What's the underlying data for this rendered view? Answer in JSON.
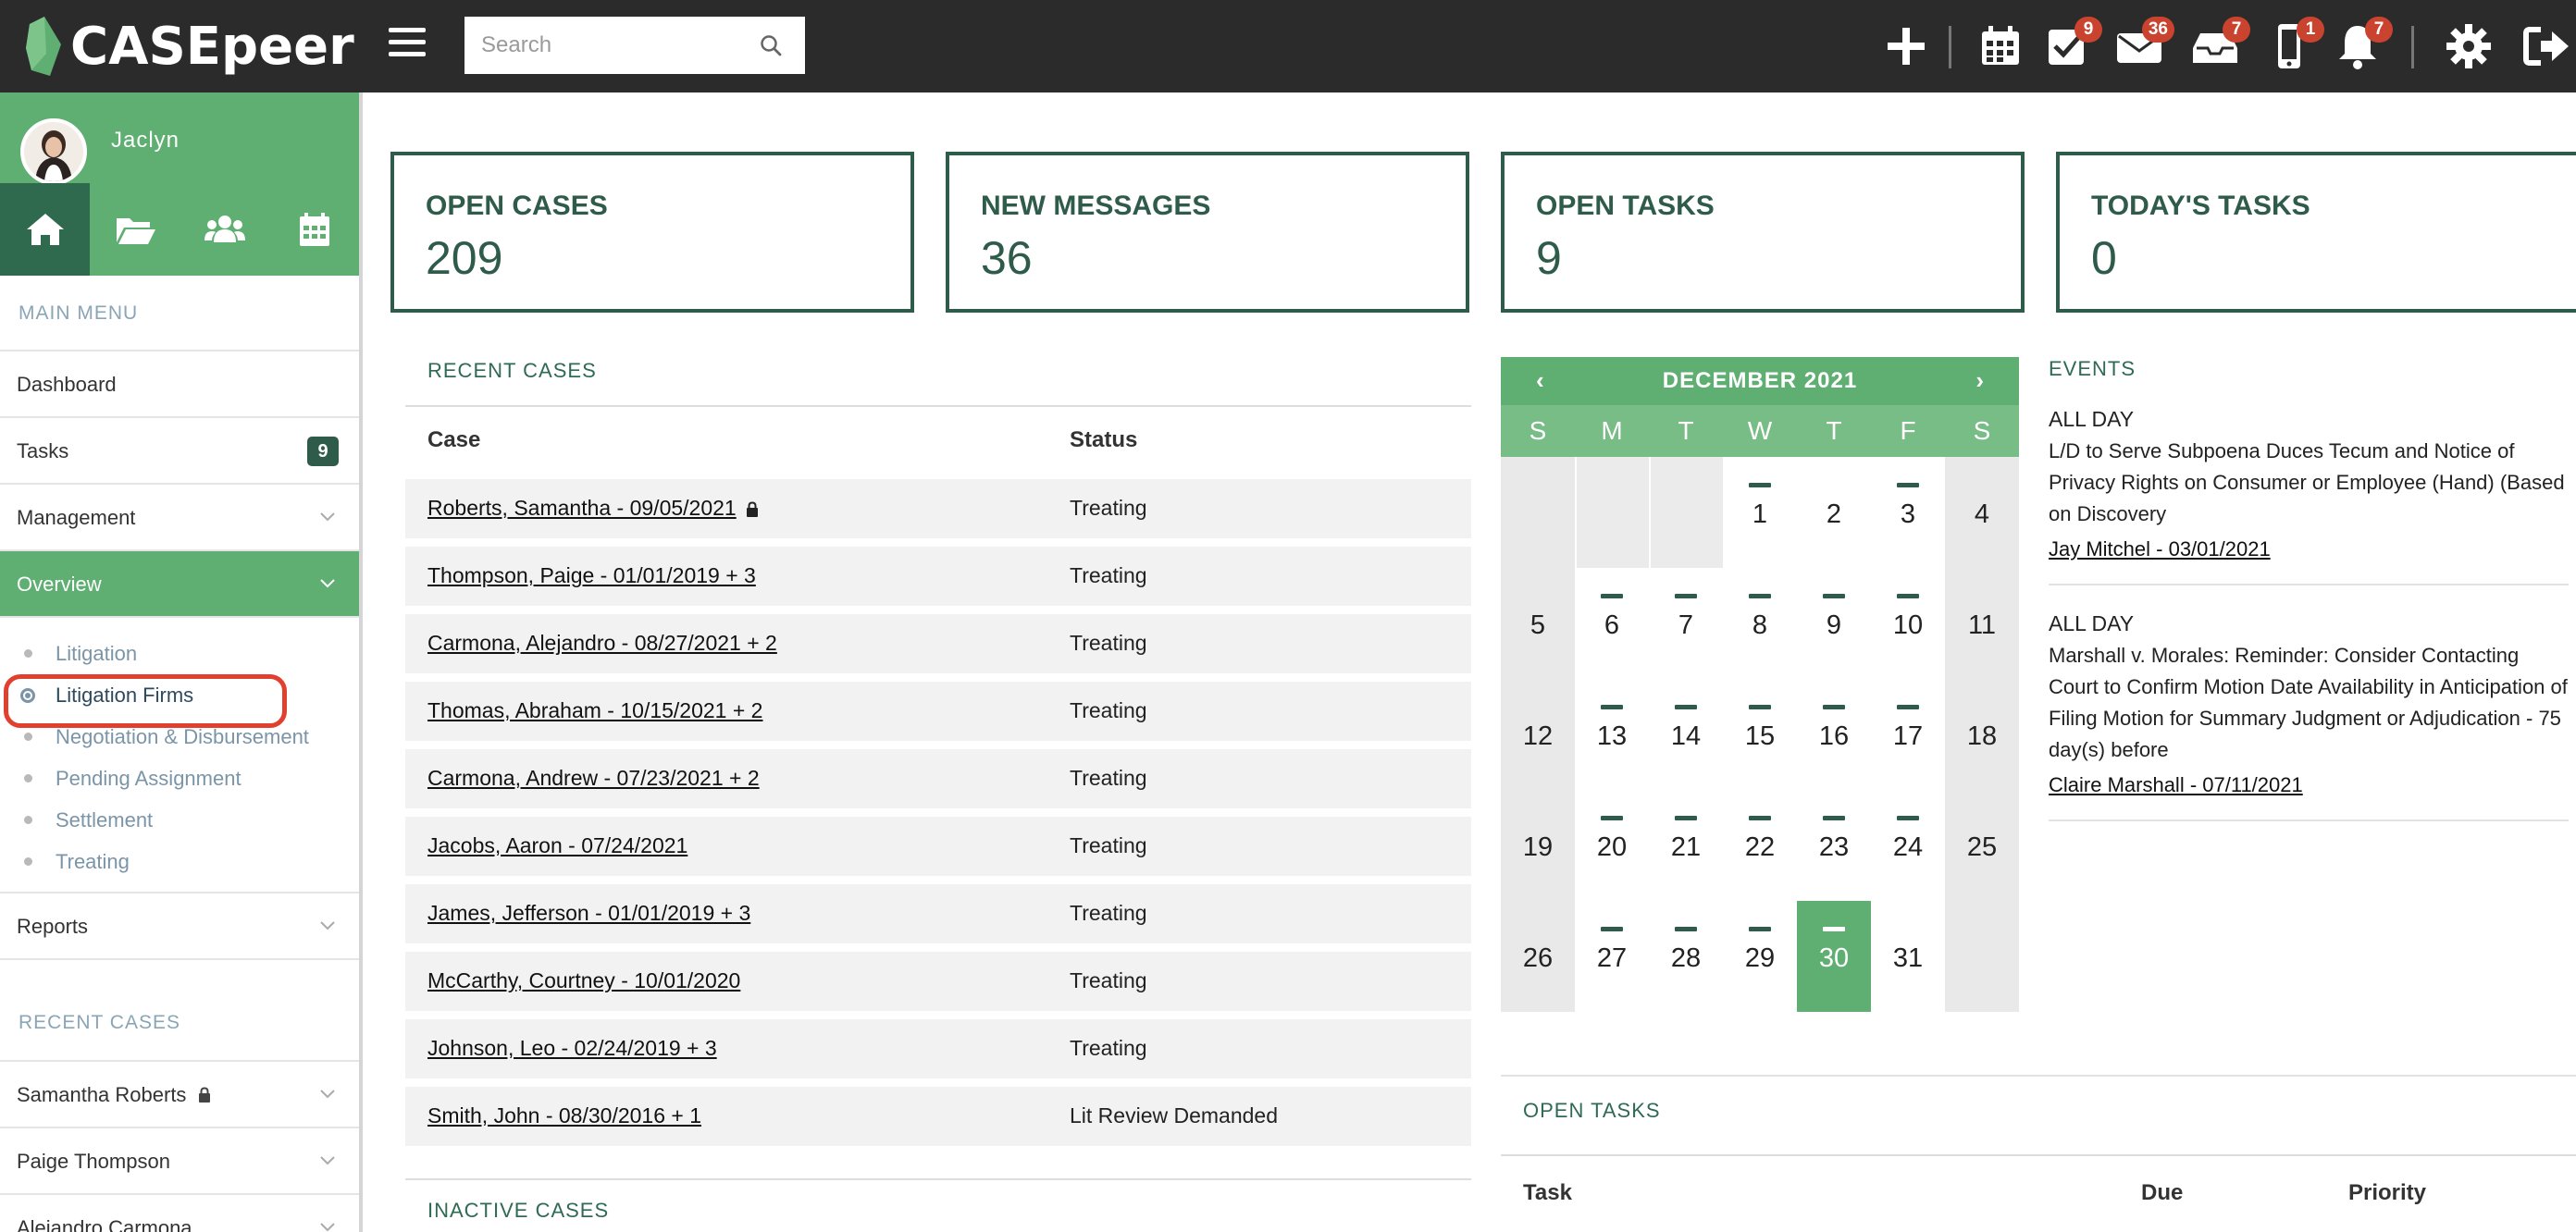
{
  "app": {
    "name": "CASEpeer"
  },
  "search": {
    "placeholder": "Search"
  },
  "topbar": {
    "badges": {
      "tasks": "9",
      "messages": "36",
      "inbox": "7",
      "mobile": "1",
      "notifications": "7"
    }
  },
  "colors": {
    "brand_green": "#5fae72",
    "dark_green": "#2f5b4a",
    "badge_red": "#c9432f",
    "topbar": "#2b2b2b"
  },
  "sidebar": {
    "user_name": "Jaclyn",
    "main_menu_label": "MAIN MENU",
    "items": {
      "dashboard": "Dashboard",
      "tasks": "Tasks",
      "tasks_count": "9",
      "management": "Management",
      "overview": "Overview",
      "reports": "Reports"
    },
    "overview_sub": [
      "Litigation",
      "Litigation Firms",
      "Negotiation & Disbursement",
      "Pending Assignment",
      "Settlement",
      "Treating"
    ],
    "recent_label": "RECENT CASES",
    "recent": [
      "Samantha Roberts",
      "Paige Thompson",
      "Alejandro Carmona"
    ]
  },
  "stats": [
    {
      "label": "OPEN CASES",
      "value": "209"
    },
    {
      "label": "NEW MESSAGES",
      "value": "36"
    },
    {
      "label": "OPEN TASKS",
      "value": "9"
    },
    {
      "label": "TODAY'S TASKS",
      "value": "0"
    }
  ],
  "recent_cases": {
    "title": "RECENT CASES",
    "col_case": "Case",
    "col_status": "Status",
    "rows": [
      {
        "case": "Roberts, Samantha - 09/05/2021",
        "status": "Treating",
        "locked": true
      },
      {
        "case": "Thompson, Paige - 01/01/2019 + 3",
        "status": "Treating"
      },
      {
        "case": "Carmona, Alejandro - 08/27/2021 + 2",
        "status": "Treating"
      },
      {
        "case": "Thomas, Abraham - 10/15/2021 + 2",
        "status": "Treating"
      },
      {
        "case": "Carmona, Andrew - 07/23/2021 + 2",
        "status": "Treating"
      },
      {
        "case": "Jacobs, Aaron - 07/24/2021",
        "status": "Treating"
      },
      {
        "case": "James, Jefferson - 01/01/2019 + 3",
        "status": "Treating"
      },
      {
        "case": "McCarthy, Courtney - 10/01/2020",
        "status": "Treating"
      },
      {
        "case": "Johnson, Leo - 02/24/2019 + 3",
        "status": "Treating"
      },
      {
        "case": "Smith, John - 08/30/2016 + 1",
        "status": "Lit Review Demanded"
      }
    ]
  },
  "inactive_cases": {
    "title": "INACTIVE CASES"
  },
  "calendar": {
    "title": "DECEMBER 2021",
    "prev": "‹",
    "next": "›",
    "dow": [
      "S",
      "M",
      "T",
      "W",
      "T",
      "F",
      "S"
    ],
    "weeks": [
      [
        "",
        "",
        "",
        "1",
        "2",
        "3",
        "4"
      ],
      [
        "5",
        "6",
        "7",
        "8",
        "9",
        "10",
        "11"
      ],
      [
        "12",
        "13",
        "14",
        "15",
        "16",
        "17",
        "18"
      ],
      [
        "19",
        "20",
        "21",
        "22",
        "23",
        "24",
        "25"
      ],
      [
        "26",
        "27",
        "28",
        "29",
        "30",
        "31",
        ""
      ]
    ],
    "event_days": [
      "1",
      "3",
      "6",
      "7",
      "8",
      "9",
      "10",
      "13",
      "14",
      "15",
      "16",
      "17",
      "20",
      "21",
      "22",
      "23",
      "24",
      "27",
      "28",
      "29",
      "30"
    ],
    "today": "30"
  },
  "events": {
    "title": "EVENTS",
    "items": [
      {
        "when": "ALL DAY",
        "desc": "L/D to Serve Subpoena Duces Tecum and Notice of Privacy Rights on Consumer or Employee (Hand) (Based on Discovery",
        "link": "Jay Mitchel - 03/01/2021"
      },
      {
        "when": "ALL DAY",
        "desc": "Marshall v. Morales: Reminder: Consider Contacting Court to Confirm Motion Date Availability in Anticipation of Filing Motion for Summary Judgment or Adjudication - 75 day(s) before",
        "link": "Claire Marshall - 07/11/2021"
      }
    ]
  },
  "open_tasks": {
    "title": "OPEN TASKS",
    "col_task": "Task",
    "col_due": "Due",
    "col_priority": "Priority"
  }
}
